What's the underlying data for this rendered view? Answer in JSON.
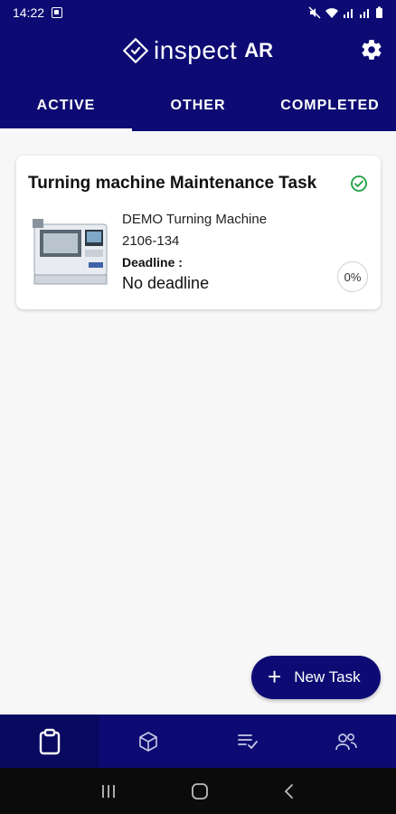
{
  "status_bar": {
    "time": "14:22"
  },
  "header": {
    "logo_text": "inspect",
    "logo_suffix": "AR"
  },
  "tabs": [
    {
      "label": "ACTIVE",
      "active": true
    },
    {
      "label": "OTHER",
      "active": false
    },
    {
      "label": "COMPLETED",
      "active": false
    }
  ],
  "task": {
    "title": "Turning machine Maintenance Task",
    "machine_name": "DEMO Turning Machine",
    "machine_id": "2106-134",
    "deadline_label": "Deadline :",
    "deadline_value": "No deadline",
    "progress": "0%"
  },
  "fab": {
    "label": "New Task"
  },
  "bottom_nav": [
    "clipboard-icon",
    "cube-icon",
    "checklist-icon",
    "users-icon"
  ],
  "colors": {
    "primary": "#0d0b73",
    "success": "#1e9e3e"
  }
}
